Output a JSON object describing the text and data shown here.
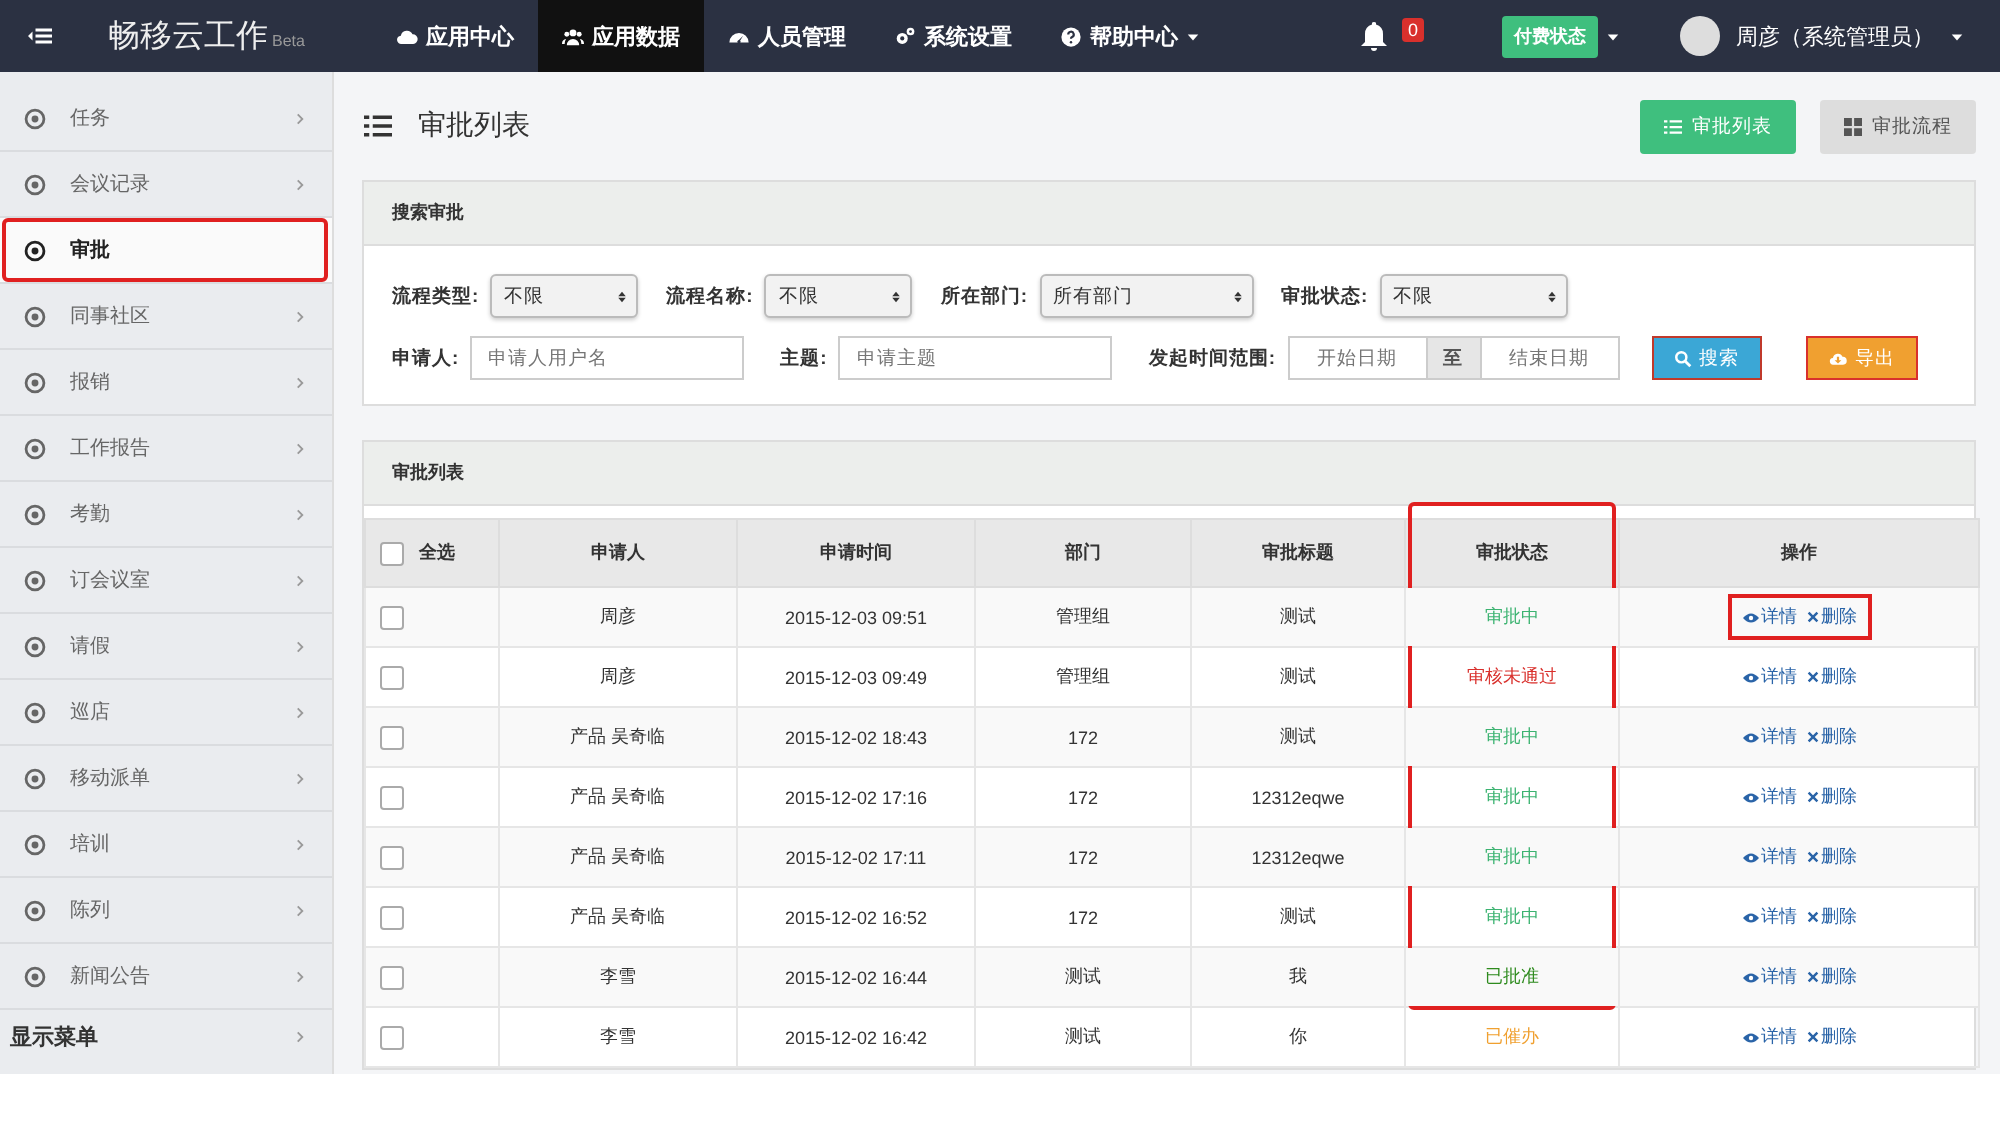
{
  "topbar": {
    "app_name": "畅移云工作",
    "app_badge": "Beta",
    "nav": [
      {
        "label": "应用中心",
        "selected": false
      },
      {
        "label": "应用数据",
        "selected": true
      },
      {
        "label": "人员管理",
        "selected": false
      },
      {
        "label": "系统设置",
        "selected": false
      },
      {
        "label": "帮助中心",
        "selected": false
      }
    ],
    "notifications": "0",
    "plan_button": "付费状态",
    "user": "周彦（系统管理员）"
  },
  "sidebar": {
    "items": [
      {
        "label": "任务",
        "selected": false,
        "highlighted": false
      },
      {
        "label": "会议记录",
        "selected": false,
        "highlighted": false
      },
      {
        "label": "审批",
        "selected": true,
        "highlighted": true
      },
      {
        "label": "同事社区",
        "selected": false,
        "highlighted": false
      },
      {
        "label": "报销",
        "selected": false,
        "highlighted": false
      },
      {
        "label": "工作报告",
        "selected": false,
        "highlighted": false
      },
      {
        "label": "考勤",
        "selected": false,
        "highlighted": false
      },
      {
        "label": "订会议室",
        "selected": false,
        "highlighted": false
      },
      {
        "label": "请假",
        "selected": false,
        "highlighted": false
      },
      {
        "label": "巡店",
        "selected": false,
        "highlighted": false
      },
      {
        "label": "移动派单",
        "selected": false,
        "highlighted": false
      },
      {
        "label": "培训",
        "selected": false,
        "highlighted": false
      },
      {
        "label": "陈列",
        "selected": false,
        "highlighted": false
      },
      {
        "label": "新闻公告",
        "selected": false,
        "highlighted": false
      }
    ],
    "footer": "显示菜单"
  },
  "page": {
    "title": "审批列表",
    "buttons": [
      {
        "label": "审批列表",
        "selected": true
      },
      {
        "label": "审批流程",
        "selected": false
      }
    ]
  },
  "search": {
    "title": "搜索审批",
    "selects": [
      {
        "label": "流程类型:",
        "value": "不限"
      },
      {
        "label": "流程名称:",
        "value": "不限"
      },
      {
        "label": "所在部门:",
        "value": "所有部门"
      },
      {
        "label": "审批状态:",
        "value": "不限"
      }
    ],
    "applicant": {
      "label": "申请人:",
      "placeholder": "申请人用户名"
    },
    "subject": {
      "label": "主题:",
      "placeholder": "申请主题"
    },
    "date_range": {
      "label": "发起时间范围:",
      "start_placeholder": "开始日期",
      "separator": "至",
      "end_placeholder": "结束日期"
    },
    "search_button": "搜索",
    "export_button": "导出"
  },
  "table": {
    "title": "审批列表",
    "select_all": {
      "label": "全选",
      "checked": false
    },
    "columns": [
      {
        "label": "申请人",
        "highlighted": false
      },
      {
        "label": "申请时间",
        "highlighted": false
      },
      {
        "label": "部门",
        "highlighted": false
      },
      {
        "label": "审批标题",
        "highlighted": false
      },
      {
        "label": "审批状态",
        "highlighted": true
      },
      {
        "label": "操作",
        "highlighted": false
      }
    ],
    "rows": [
      {
        "checked": false,
        "applicant": "周彦",
        "time": "2015-12-03 09:51",
        "dept": "管理组",
        "subject": "测试",
        "status": "审批中",
        "color": "#3cb371",
        "detail": "详情",
        "delete": "删除",
        "highlighted": true
      },
      {
        "checked": false,
        "applicant": "周彦",
        "time": "2015-12-03 09:49",
        "dept": "管理组",
        "subject": "测试",
        "status": "审核未通过",
        "color": "#d9302c",
        "detail": "详情",
        "delete": "删除",
        "highlighted": false
      },
      {
        "checked": false,
        "applicant": "产品 吴奇临",
        "time": "2015-12-02 18:43",
        "dept": "172",
        "subject": "测试",
        "status": "审批中",
        "color": "#3cb371",
        "detail": "详情",
        "delete": "删除",
        "highlighted": false
      },
      {
        "checked": false,
        "applicant": "产品 吴奇临",
        "time": "2015-12-02 17:16",
        "dept": "172",
        "subject": "12312eqwe",
        "status": "审批中",
        "color": "#3cb371",
        "detail": "详情",
        "delete": "删除",
        "highlighted": false
      },
      {
        "checked": false,
        "applicant": "产品 吴奇临",
        "time": "2015-12-02 17:11",
        "dept": "172",
        "subject": "12312eqwe",
        "status": "审批中",
        "color": "#3cb371",
        "detail": "详情",
        "delete": "删除",
        "highlighted": false
      },
      {
        "checked": false,
        "applicant": "产品 吴奇临",
        "time": "2015-12-02 16:52",
        "dept": "172",
        "subject": "测试",
        "status": "审批中",
        "color": "#3cb371",
        "detail": "详情",
        "delete": "删除",
        "highlighted": false
      },
      {
        "checked": false,
        "applicant": "李雪",
        "time": "2015-12-02 16:44",
        "dept": "测试",
        "subject": "我",
        "status": "已批准",
        "color": "#2e8b1e",
        "detail": "详情",
        "delete": "删除",
        "highlighted": false
      },
      {
        "checked": false,
        "applicant": "李雪",
        "time": "2015-12-02 16:42",
        "dept": "测试",
        "subject": "你",
        "status": "已催办",
        "color": "#f0a030",
        "detail": "详情",
        "delete": "删除",
        "highlighted": false
      }
    ]
  }
}
